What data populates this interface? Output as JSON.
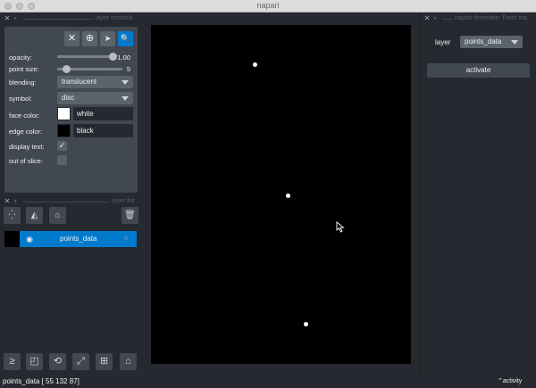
{
  "window": {
    "title": "napari"
  },
  "layer_controls_dock": {
    "title": "layer controls"
  },
  "tools": {
    "delete": "✕",
    "add": "⊕",
    "select": "➤",
    "pan_zoom": "🔍"
  },
  "controls": {
    "opacity": {
      "label": "opacity:",
      "value": "1.00",
      "level": 1.0
    },
    "point_size": {
      "label": "point size:",
      "value": "5",
      "level": 0.05
    },
    "blending": {
      "label": "blending:",
      "value": "translucent"
    },
    "symbol": {
      "label": "symbol:",
      "value": "disc"
    },
    "face_color": {
      "label": "face color:",
      "value": "white",
      "swatch": "#ffffff"
    },
    "edge_color": {
      "label": "edge color:",
      "value": "black",
      "swatch": "#000000"
    },
    "display_text": {
      "label": "display text:",
      "checked": true
    },
    "out_of_slice": {
      "label": "out of slice:",
      "checked": false
    }
  },
  "layer_list_dock": {
    "title": "layer list"
  },
  "layers": [
    {
      "name": "points_data",
      "visible": true,
      "selected": true
    }
  ],
  "right_dock": {
    "title": "napari-threedee: Point ma",
    "layer_label": "layer",
    "layer_value": "points_data",
    "activate_label": "activate"
  },
  "status": {
    "text": "points_data [ 55 132  87]",
    "activity": "activity"
  },
  "colors": {
    "accent": "#007acc",
    "background": "#262930",
    "panel": "#414851"
  }
}
